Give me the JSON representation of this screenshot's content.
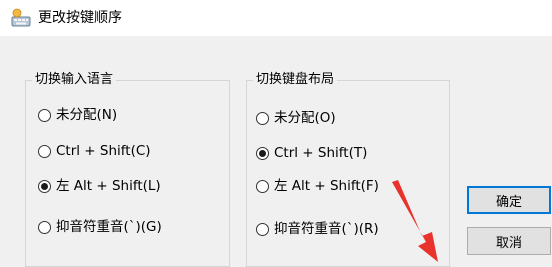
{
  "window": {
    "title": "更改按键顺序"
  },
  "input_language_group": {
    "title": "切换输入语言",
    "options": [
      {
        "label": "未分配(N)",
        "checked": false
      },
      {
        "label": "Ctrl + Shift(C)",
        "checked": false
      },
      {
        "label": "左 Alt + Shift(L)",
        "checked": true
      },
      {
        "label": "抑音符重音(`)(G)",
        "checked": false
      }
    ]
  },
  "keyboard_layout_group": {
    "title": "切换键盘布局",
    "options": [
      {
        "label": "未分配(O)",
        "checked": false
      },
      {
        "label": "Ctrl + Shift(T)",
        "checked": true
      },
      {
        "label": "左 Alt + Shift(F)",
        "checked": false
      },
      {
        "label": "抑音符重音(`)(R)",
        "checked": false
      }
    ]
  },
  "buttons": {
    "ok": "确定",
    "cancel": "取消"
  },
  "colors": {
    "annotation_arrow": "#e8322b",
    "default_button_border": "#0078d7"
  }
}
